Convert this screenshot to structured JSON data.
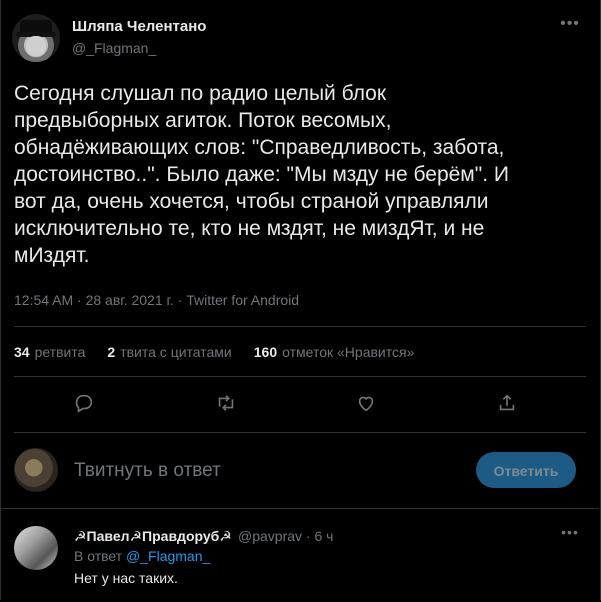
{
  "author": {
    "display_name": "Шляпа Челентано",
    "handle": "@_Flagman_"
  },
  "tweet": {
    "text": "Сегодня слушал по радио целый блок\nпредвыборных агиток. Поток весомых,\nобнадёживающих слов: \"Справедливость, забота,\nдостоинство..\". Было даже: \"Мы мзду не берём\". И\nвот да, очень хочется, чтобы страной управляли\nисключительно те, кто не мздят, не миздЯт, и не\nмИздят.",
    "meta": "12:54 AM · 28 авг. 2021 г. · Twitter for Android"
  },
  "stats": {
    "retweets_count": "34",
    "retweets_label": "ретвита",
    "quotes_count": "2",
    "quotes_label": "твита с цитатами",
    "likes_count": "160",
    "likes_label": "отметок «Нравится»"
  },
  "icons": {
    "more": "more-icon",
    "reply": "reply-icon",
    "retweet": "retweet-icon",
    "like": "like-icon",
    "share": "share-icon"
  },
  "composer": {
    "placeholder": "Твитнуть в ответ",
    "button_label": "Ответить"
  },
  "reply": {
    "display_name": "☭Павел☭Правдоруб☭",
    "handle_time": "@pavprav · 6 ч",
    "reply_to_prefix": "В ответ",
    "reply_to_handle": "@_Flagman_",
    "text": "Нет у нас таких."
  },
  "colors": {
    "background": "#000000",
    "accent": "#1d9bf0",
    "muted": "#71767b",
    "button_bg": "#1d5b87"
  }
}
